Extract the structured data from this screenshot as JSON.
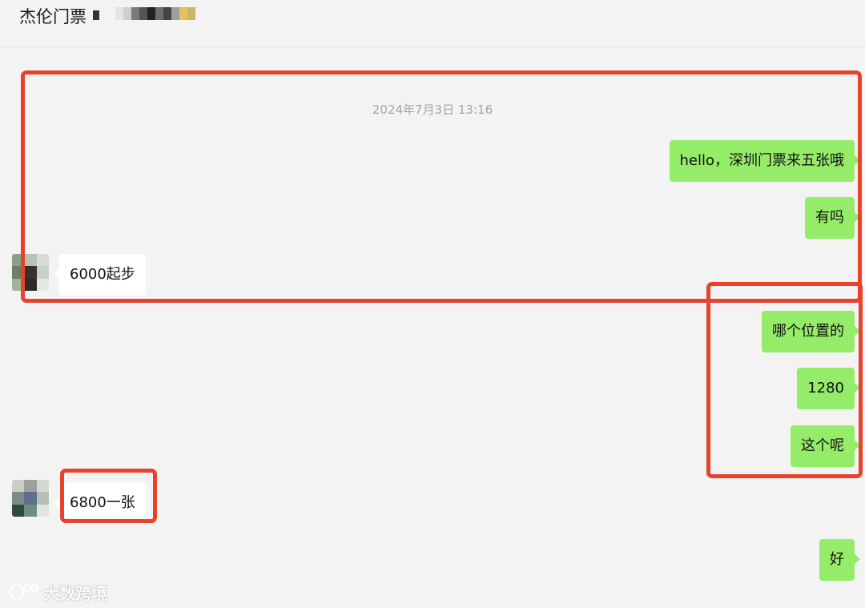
{
  "header": {
    "title": "杰伦门票"
  },
  "timestamp": "2024年7月3日 13:16",
  "messages": {
    "m1": "hello，深圳门票来五张哦",
    "m2": "有吗",
    "m3": "6000起步",
    "m4": "哪个位置的",
    "m5": "1280",
    "m6": "这个呢",
    "m7": "6800一张",
    "m8": "好"
  },
  "watermark": "大数跨境",
  "colors": {
    "outgoing_bubble": "#95ec69",
    "incoming_bubble": "#ffffff",
    "annotation": "#e8422b",
    "background": "#f3f3f3"
  }
}
